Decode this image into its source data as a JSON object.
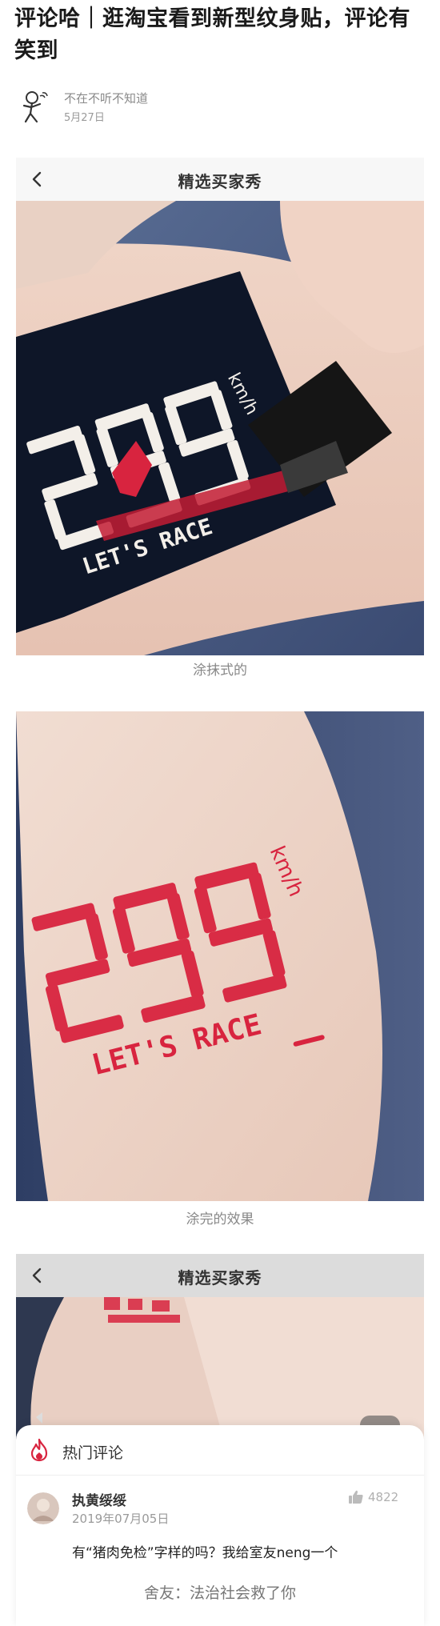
{
  "article": {
    "title": "评论哈｜逛淘宝看到新型纹身贴，评论有笑到",
    "author": "不在不听不知道",
    "date": "5月27日"
  },
  "app_bar": {
    "title": "精选买家秀",
    "back_icon": "chevron-left-icon"
  },
  "captions": {
    "first": "涂抹式的",
    "second": "涂完的效果"
  },
  "comments": {
    "title": "热门评论",
    "icon": "fire-icon",
    "item": {
      "user": "执黄绥绥",
      "date": "2019年07月05日",
      "likes": "4822",
      "text": "有“猪肉免检”字样的吗？我给室友neng一个"
    },
    "bottom_caption": "舍友：法治社会救了你"
  },
  "colors": {
    "accent_red": "#d8243f",
    "title_text": "#1a1a1a",
    "muted_text": "#888888"
  }
}
